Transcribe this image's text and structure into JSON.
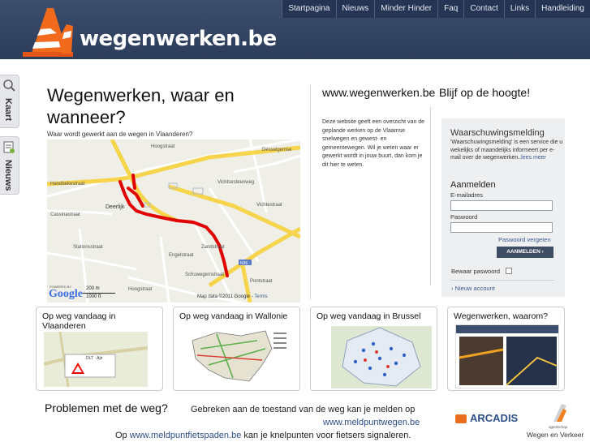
{
  "header": {
    "logo_text": "wegenwerken.be",
    "nav": [
      "Startpagina",
      "Nieuws",
      "Minder Hinder",
      "Faq",
      "Contact",
      "Links",
      "Handleiding"
    ]
  },
  "side_tabs": [
    {
      "label": "Kaart",
      "icon": "magnifier-icon"
    },
    {
      "label": "Nieuws",
      "icon": "news-icon"
    }
  ],
  "main": {
    "title": "Wegenwerken, waar en wanneer?",
    "map_caption": "Waar wordt gewerkt aan de wegen in Vlaanderen?",
    "map": {
      "street_labels": [
        "Hoogstraat",
        "Harelbekestraat",
        "Deerlijk",
        "Vichtestraat",
        "Stationsstraat",
        "Engelstraat",
        "Zandstraat",
        "Cassinastraat",
        "Desselgemse",
        "Vichtsesteenweg",
        "Pontstraat",
        "Schuwegemstraat",
        "Hoogstraat"
      ],
      "scale_m": "200 m",
      "scale_ft": "1000 ft",
      "attribution": "Map data ©2011 Google -",
      "terms": "Terms",
      "powered_by": "POWERED BY",
      "google": "Google",
      "road_badge": "N36"
    }
  },
  "middle": {
    "title": "www.wegenwerken.be",
    "text": "Deze website geeft een overzicht van de geplande werken op de Vlaamse snelwegen en gewest- en gemeentewegen. Wil je weten waar er gewerkt wordt in jouw buurt, dan kom je dit hier te weten."
  },
  "right": {
    "title": "Blijf op de hoogte!",
    "warning": {
      "title": "Waarschuwingsmelding",
      "text": "'Waarschuwingsmelding' is een service die u wekelijks of maandelijks informeert per e-mail over de wegenwerken..",
      "more": "lees meer"
    },
    "login": {
      "title": "Aanmelden",
      "email_label": "E-mailadres",
      "email_value": "",
      "password_label": "Paswoord",
      "password_value": "",
      "forgot": "Paswoord vergeten",
      "button": "AANMELDEN",
      "remember": "Bewaar paswoord",
      "new_account": "Nieuw account"
    }
  },
  "cards": [
    {
      "title": "Op weg vandaag in Vlaanderen",
      "thumb_text": "DLT · Ajir"
    },
    {
      "title": "Op weg vandaag in Wallonie"
    },
    {
      "title": "Op weg vandaag in Brussel"
    },
    {
      "title": "Wegenwerken, waarom?"
    }
  ],
  "footer": {
    "problems_title": "Problemen met de weg?",
    "problems_text": "Gebreken aan de toestand van de weg kan je melden op",
    "problems_link": "www.meldpuntwegen.be",
    "bike_prefix": "Op",
    "bike_link": "www.meldpuntfietspaden.be",
    "bike_suffix": "kan je knelpunten voor fietsers signaleren.",
    "sponsor1": "ARCADIS",
    "sponsor2": "Wegen en Verkeer",
    "sponsor2_small": "agentschap"
  },
  "colors": {
    "header_bg": "#2c3d5b",
    "route_red": "#e00000",
    "link_blue": "#2c4e87",
    "cone_orange": "#f26a1b"
  }
}
